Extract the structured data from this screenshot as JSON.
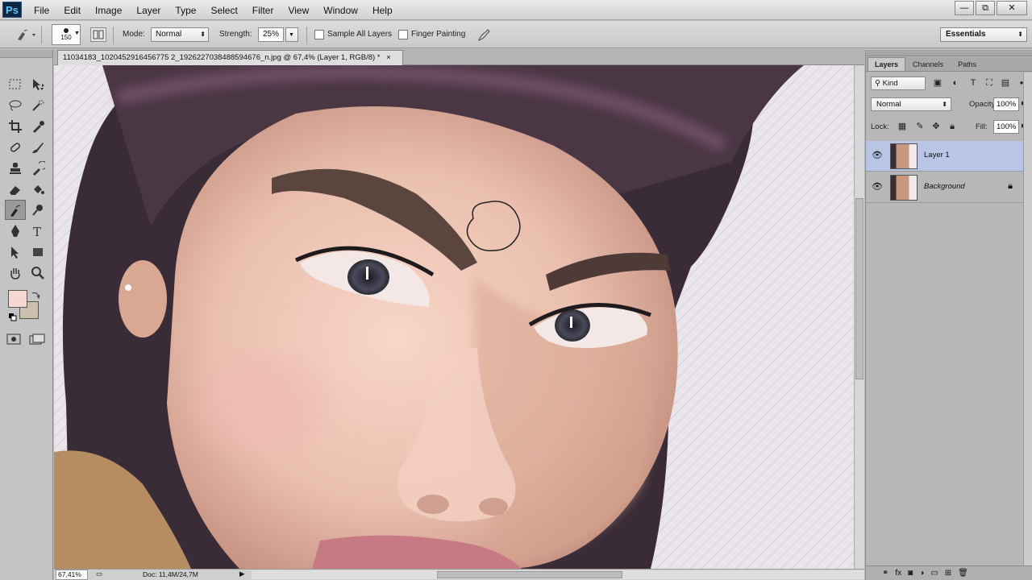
{
  "app": {
    "logo": "Ps"
  },
  "menu": [
    "File",
    "Edit",
    "Image",
    "Layer",
    "Type",
    "Select",
    "Filter",
    "View",
    "Window",
    "Help"
  ],
  "window_controls": {
    "minimize": "—",
    "restore": "⧉",
    "close": "✕"
  },
  "options": {
    "brush_size": "150",
    "mode_label": "Mode:",
    "mode_value": "Normal",
    "strength_label": "Strength:",
    "strength_value": "25%",
    "sample_all_layers": "Sample All Layers",
    "finger_painting": "Finger Painting",
    "workspace": "Essentials"
  },
  "document": {
    "tab_title": "11034183_1020452916456775 2_1926227038488594676_n.jpg @ 67,4% (Layer 1, RGB/8) *",
    "zoom": "67,41%",
    "doc_size": "Doc: 11,4M/24,7M"
  },
  "colors": {
    "foreground": "#f7d7d2",
    "background": "#cdbfae",
    "selected_layer": "#b8c5e6"
  },
  "panels": {
    "tabs": [
      "Layers",
      "Channels",
      "Paths"
    ],
    "kind_filter": "Kind",
    "blend_mode": "Normal",
    "opacity_label": "Opacity:",
    "opacity_value": "100%",
    "lock_label": "Lock:",
    "fill_label": "Fill:",
    "fill_value": "100%",
    "layers": [
      {
        "name": "Layer 1",
        "selected": true,
        "visible": true
      },
      {
        "name": "Background",
        "selected": false,
        "visible": true,
        "locked": true
      }
    ]
  }
}
